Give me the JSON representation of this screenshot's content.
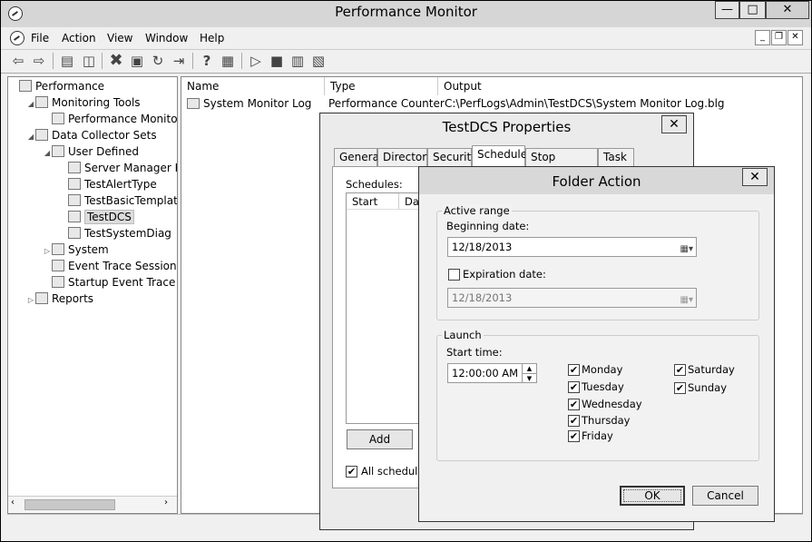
{
  "window": {
    "title": "Performance Monitor"
  },
  "caption_buttons": {
    "minimize": "—",
    "maximize": "□",
    "close": "✕"
  },
  "menu": [
    "File",
    "Action",
    "View",
    "Window",
    "Help"
  ],
  "tree": [
    {
      "label": "Performance",
      "level": 0,
      "expander": ""
    },
    {
      "label": "Monitoring Tools",
      "level": 1,
      "expander": "◢"
    },
    {
      "label": "Performance Monitor",
      "level": 2,
      "expander": ""
    },
    {
      "label": "Data Collector Sets",
      "level": 1,
      "expander": "◢"
    },
    {
      "label": "User Defined",
      "level": 2,
      "expander": "◢"
    },
    {
      "label": "Server Manager Per",
      "level": 3,
      "expander": ""
    },
    {
      "label": "TestAlertType",
      "level": 3,
      "expander": ""
    },
    {
      "label": "TestBasicTemplate",
      "level": 3,
      "expander": ""
    },
    {
      "label": "TestDCS",
      "level": 3,
      "expander": "",
      "selected": true
    },
    {
      "label": "TestSystemDiag",
      "level": 3,
      "expander": ""
    },
    {
      "label": "System",
      "level": 2,
      "expander": "▷"
    },
    {
      "label": "Event Trace Sessions",
      "level": 2,
      "expander": ""
    },
    {
      "label": "Startup Event Trace Ses",
      "level": 2,
      "expander": ""
    },
    {
      "label": "Reports",
      "level": 1,
      "expander": "▷"
    }
  ],
  "list": {
    "columns": [
      "Name",
      "Type",
      "Output"
    ],
    "rows": [
      {
        "name": "System Monitor Log",
        "type": "Performance Counter",
        "output": "C:\\PerfLogs\\Admin\\TestDCS\\System Monitor Log.blg"
      }
    ]
  },
  "properties_dialog": {
    "title": "TestDCS Properties",
    "tabs": [
      "General",
      "Directory",
      "Security",
      "Schedule",
      "Stop Condition",
      "Task"
    ],
    "active_tab": "Schedule",
    "schedules_label": "Schedules:",
    "schedule_columns": [
      "Start",
      "Day"
    ],
    "add_button": "Add",
    "all_schedules_label": "All schedules",
    "all_schedules_checked": true
  },
  "folder_action_dialog": {
    "title": "Folder Action",
    "active_range": {
      "group_label": "Active range",
      "beginning_label": "Beginning date:",
      "beginning_value": "12/18/2013",
      "expiration_label": "Expiration date:",
      "expiration_checked": false,
      "expiration_value": "12/18/2013"
    },
    "launch": {
      "group_label": "Launch",
      "start_time_label": "Start time:",
      "start_time_value": "12:00:00 AM",
      "days": [
        {
          "label": "Monday",
          "checked": true
        },
        {
          "label": "Tuesday",
          "checked": true
        },
        {
          "label": "Wednesday",
          "checked": true
        },
        {
          "label": "Thursday",
          "checked": true
        },
        {
          "label": "Friday",
          "checked": true
        },
        {
          "label": "Saturday",
          "checked": true
        },
        {
          "label": "Sunday",
          "checked": true
        }
      ]
    },
    "ok_label": "OK",
    "cancel_label": "Cancel"
  }
}
